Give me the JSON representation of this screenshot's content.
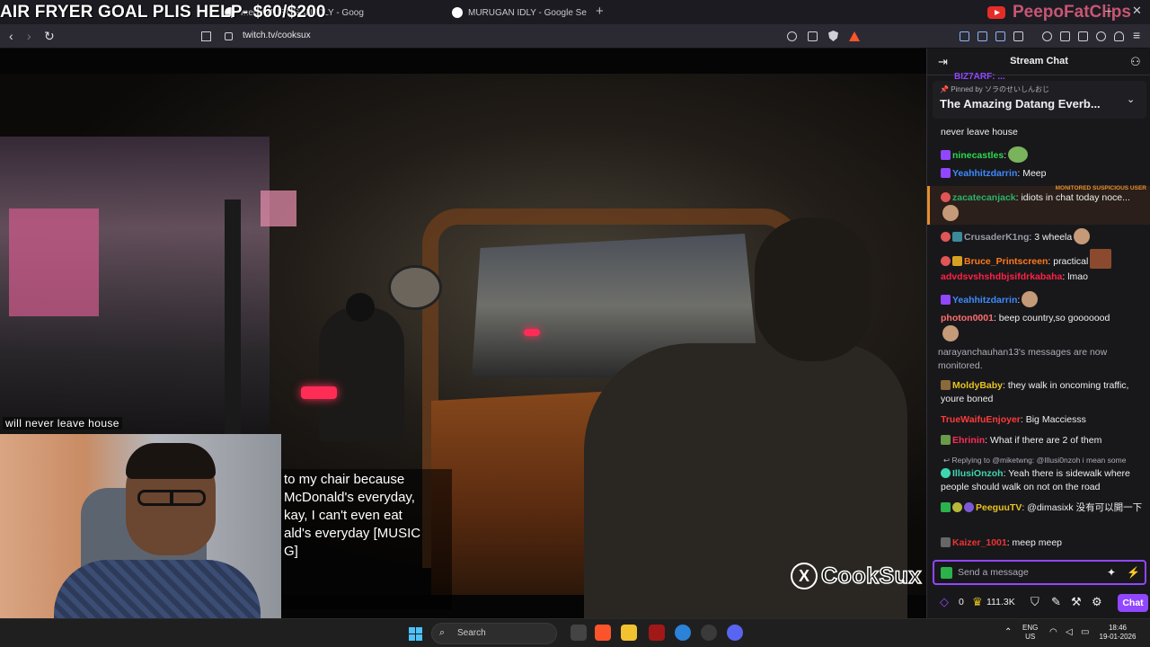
{
  "browser": {
    "stream_title": "AIR FRYER GOAL PLIS HELP- $60/$200",
    "tabs": [
      {
        "label": "medu MURUGAN IDLY - Goog"
      },
      {
        "label": "MURUGAN IDLY - Google Search"
      }
    ],
    "overlay_brand": "PeepoFatClips",
    "url": "twitch.tv/cooksux"
  },
  "player": {
    "caption_small": "will never leave house",
    "subtitle": "to my chair because\nMcDonald's everyday,\nkay, I can't even eat\nald's everyday [MUSIC\nG]",
    "watermark": "CookSux"
  },
  "chat": {
    "header_title": "Stream Chat",
    "pinned": {
      "by_label": "Pinned by",
      "by_user": "ソラのせいしんおじ",
      "message": "The Amazing Datang Everb..."
    },
    "partial_top": "BIZ7ARF: ...",
    "suspicious_label": "MONITORED SUSPICIOUS USER",
    "messages": [
      {
        "user": "",
        "text": "never leave house",
        "color": "#efeff1"
      },
      {
        "user": "ninecastles",
        "text": ":",
        "color": "#2bd94d"
      },
      {
        "user": "Yeahhitzdarrin",
        "text": ": Meep",
        "color": "#3d8bff"
      },
      {
        "user": "zacatecanjack",
        "text": ": idiots in chat today noce...",
        "color": "#29b36a"
      },
      {
        "user": "CrusaderK1ng",
        "text": ": 3 wheela",
        "color": "#9a9aa8"
      },
      {
        "user": "Bruce_Printscreen",
        "text": ": practical",
        "color": "#ff7a1a"
      },
      {
        "user": "advdsvshshdbjsifdrkabaha",
        "text": ": lmao",
        "color": "#ff2244"
      },
      {
        "user": "Yeahhitzdarrin",
        "text": ":",
        "color": "#3d8bff"
      },
      {
        "user": "photon0001",
        "text": ": beep country,so gooooood",
        "color": "#ff6e6e"
      },
      {
        "user": "MoldyBaby",
        "text": ": they walk in oncoming traffic, youre boned",
        "color": "#e8c21f"
      },
      {
        "user": "TrueWaifuEnjoyer",
        "text": ": Big Macciesss",
        "color": "#ff3a3a"
      },
      {
        "user": "Ehrinin",
        "text": ": What if there are 2 of them",
        "color": "#ff2d55"
      },
      {
        "user": "IllusiOnzoh",
        "text": ": Yeah there is sidewalk where people should walk on not on the road",
        "color": "#3ed6b0"
      },
      {
        "user": "PeeguuTV",
        "text": ": @dimasixk 没有可以開一下",
        "color": "#e8c21f"
      },
      {
        "user": "Kaizer_1001",
        "text": ": meep meep",
        "color": "#e33"
      }
    ],
    "system_message": "narayanchauhan13's messages are now monitored.",
    "reply_to": "Replying to @miketwng: @Illusi0nzoh i mean some",
    "input_placeholder": "Send a message",
    "points": "0",
    "bits": "111.3K",
    "chat_button": "Chat"
  },
  "taskbar": {
    "search_label": "Search",
    "lang": "ENG",
    "region": "US",
    "time": "18:46",
    "date": "19-01-2026"
  },
  "colors": {
    "twitch_purple": "#9147ff",
    "chat_bg": "#18181b",
    "taskbar_bg": "#1f1f1f"
  }
}
